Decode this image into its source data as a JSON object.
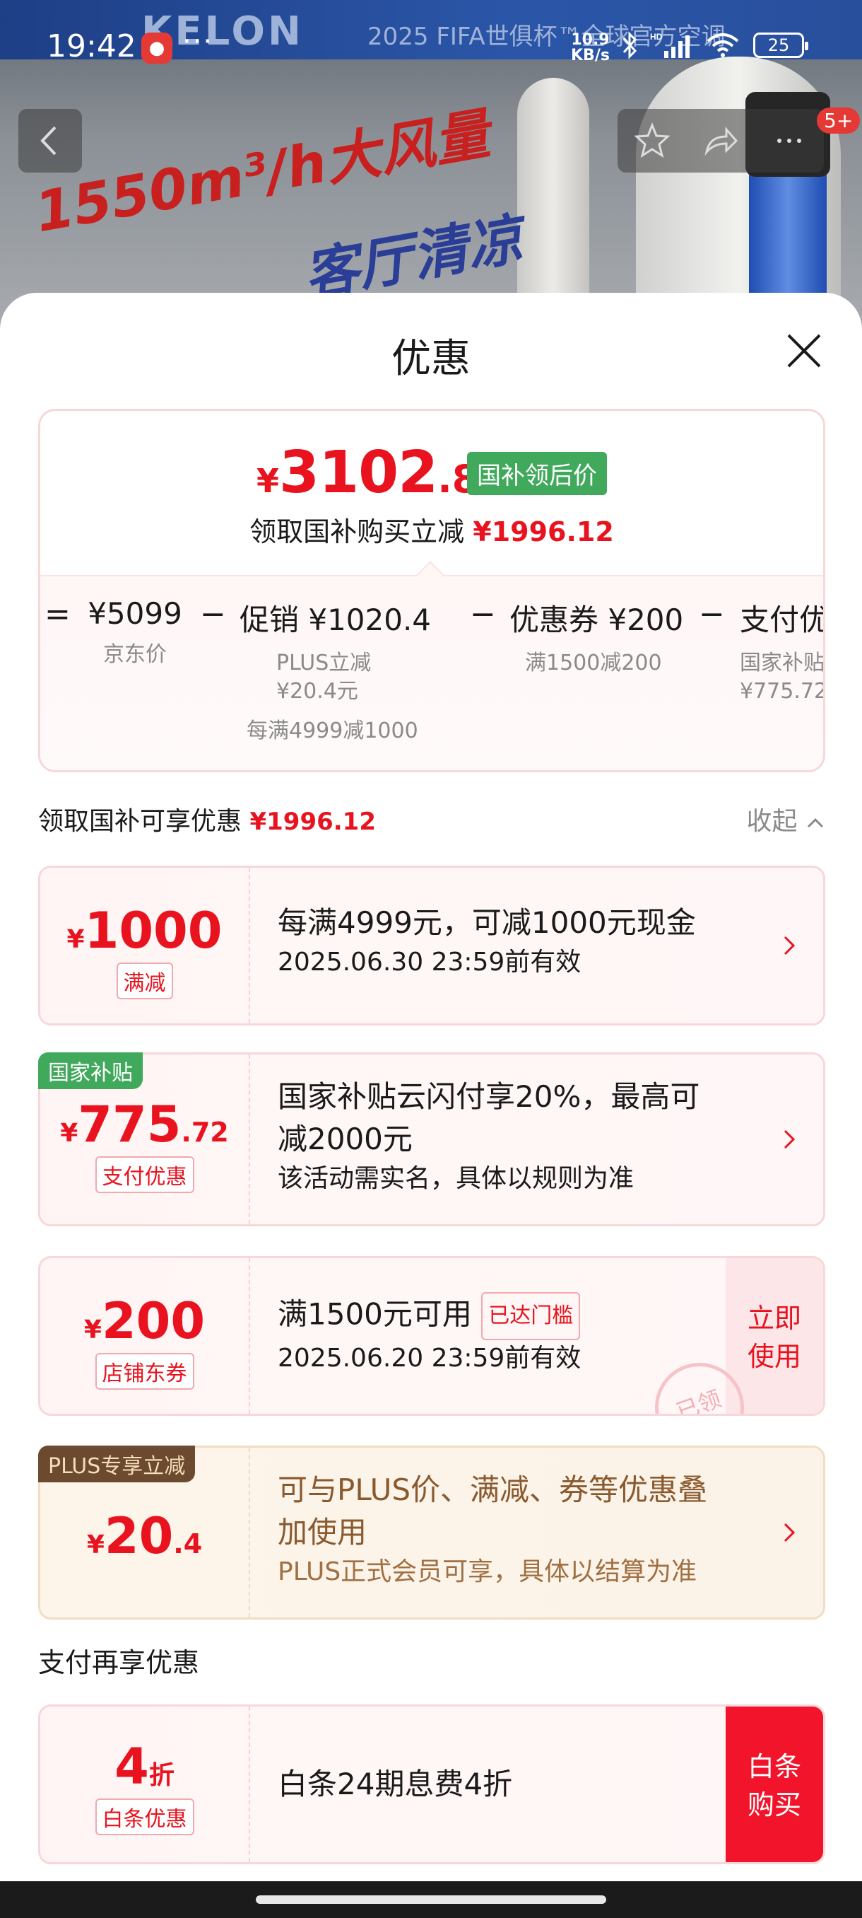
{
  "status_bar": {
    "time": "19:42",
    "net_speed_top": "10.9",
    "net_speed_unit": "KB/s",
    "battery": "25",
    "icons": [
      "notification-app-icon",
      "bluetooth-icon",
      "hd-signal-icon",
      "wifi-icon",
      "battery-icon"
    ]
  },
  "background": {
    "banner_brand": "KELON",
    "banner_tag": "2025 FIFA世俱杯™全球官方空调",
    "promo_line1": "1550m³/h大风量",
    "promo_line2": "客厅清凉",
    "cart_badge": "5+"
  },
  "sheet": {
    "title": "优惠"
  },
  "price_card": {
    "currency": "¥",
    "price_int": "3102",
    "price_dec": ".88",
    "price_tag": "国补领后价",
    "subsidy_text": "领取国补购买立减",
    "subsidy_amount": "¥1996.12",
    "calc": {
      "eq": "=",
      "jd_price": "¥5099",
      "jd_label": "京东价",
      "minus1": "−",
      "promo_value": "促销 ¥1020.4",
      "promo_sub1": "PLUS立减",
      "promo_sub2": "¥20.4元",
      "promo_sub3": "每满4999减1000",
      "minus2": "−",
      "coupon_value": "优惠券 ¥200",
      "coupon_sub": "满1500减200",
      "minus3": "−",
      "pay_value": "支付优惠 ¥",
      "pay_sub1": "国家补贴云闪",
      "pay_sub2": "¥775.72"
    }
  },
  "section": {
    "label": "领取国补可享优惠",
    "amount": "¥1996.12",
    "collapse": "收起"
  },
  "coupons": [
    {
      "yen": "¥",
      "num": "1000",
      "dec": "",
      "tag": "满减",
      "main": "每满4999元，可减1000元现金",
      "sub": "2025.06.30 23:59前有效"
    },
    {
      "corner": "国家补贴",
      "yen": "¥",
      "num": "775",
      "dec": ".72",
      "tag": "支付优惠",
      "main1": "国家补贴云闪付享20%，最高可",
      "main2": "减2000元",
      "sub": "该活动需实名，具体以规则为准"
    },
    {
      "yen": "¥",
      "num": "200",
      "dec": "",
      "tag": "店铺东券",
      "main": "满1500元可用",
      "reached": "已达门槛",
      "sub": "2025.06.20 23:59前有效",
      "action_line1": "立即",
      "action_line2": "使用",
      "stamp": "已领"
    },
    {
      "corner": "PLUS专享立减",
      "yen": "¥",
      "num": "20",
      "dec": ".4",
      "main1": "可与PLUS价、满减、券等优惠叠",
      "main2": "加使用",
      "sub": "PLUS正式会员可享，具体以结算为准"
    }
  ],
  "pay_section": {
    "label": "支付再享优惠",
    "num": "4",
    "unit": "折",
    "tag": "白条优惠",
    "main": "白条24期息费4折",
    "action_line1": "白条",
    "action_line2": "购买"
  },
  "colors": {
    "accent_red": "#e8131f",
    "tag_green": "#41a95c",
    "plus_brown": "#6b4a2f",
    "card_border": "#f8d6d9"
  }
}
